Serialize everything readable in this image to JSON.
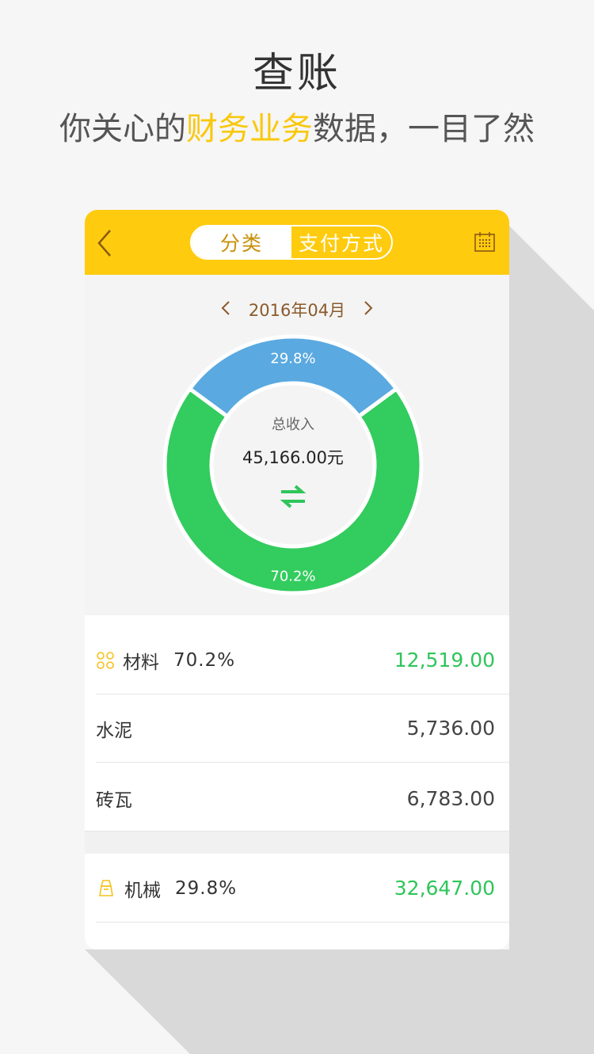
{
  "promo": {
    "title": "查账",
    "subtitle_prefix": "你关心的",
    "subtitle_highlight": "财务业务",
    "subtitle_suffix": "数据，一目了然"
  },
  "header": {
    "back_icon": "chevron-left-icon",
    "tabs": [
      {
        "label": "分类",
        "active": true
      },
      {
        "label": "支付方式",
        "active": false
      }
    ],
    "calendar_icon": "calendar-icon",
    "background": "#fecb0f"
  },
  "month": {
    "label": "2016年04月",
    "prev_icon": "chevron-left-icon",
    "next_icon": "chevron-right-icon"
  },
  "chart_data": {
    "type": "pie",
    "categories": [
      "材料",
      "机械"
    ],
    "values": [
      70.2,
      29.8
    ],
    "labels": [
      "70.2%",
      "29.8%"
    ],
    "colors": [
      "#33cc5e",
      "#5aa9e0"
    ],
    "center_caption": "总收入",
    "center_value": "45,166.00元",
    "swap_icon": "swap-arrows-icon"
  },
  "categories": [
    {
      "icon": "material-grid-icon",
      "name": "材料",
      "percent": "70.2%",
      "amount": "12,519.00",
      "items": [
        {
          "name": "水泥",
          "amount": "5,736.00"
        },
        {
          "name": "砖瓦",
          "amount": "6,783.00"
        }
      ]
    },
    {
      "icon": "machine-icon",
      "name": "机械",
      "percent": "29.8%",
      "amount": "32,647.00",
      "items": []
    }
  ],
  "colors": {
    "accent": "#fecb0f",
    "amount_green": "#2fc55a",
    "date_brown": "#8a5a2b"
  }
}
